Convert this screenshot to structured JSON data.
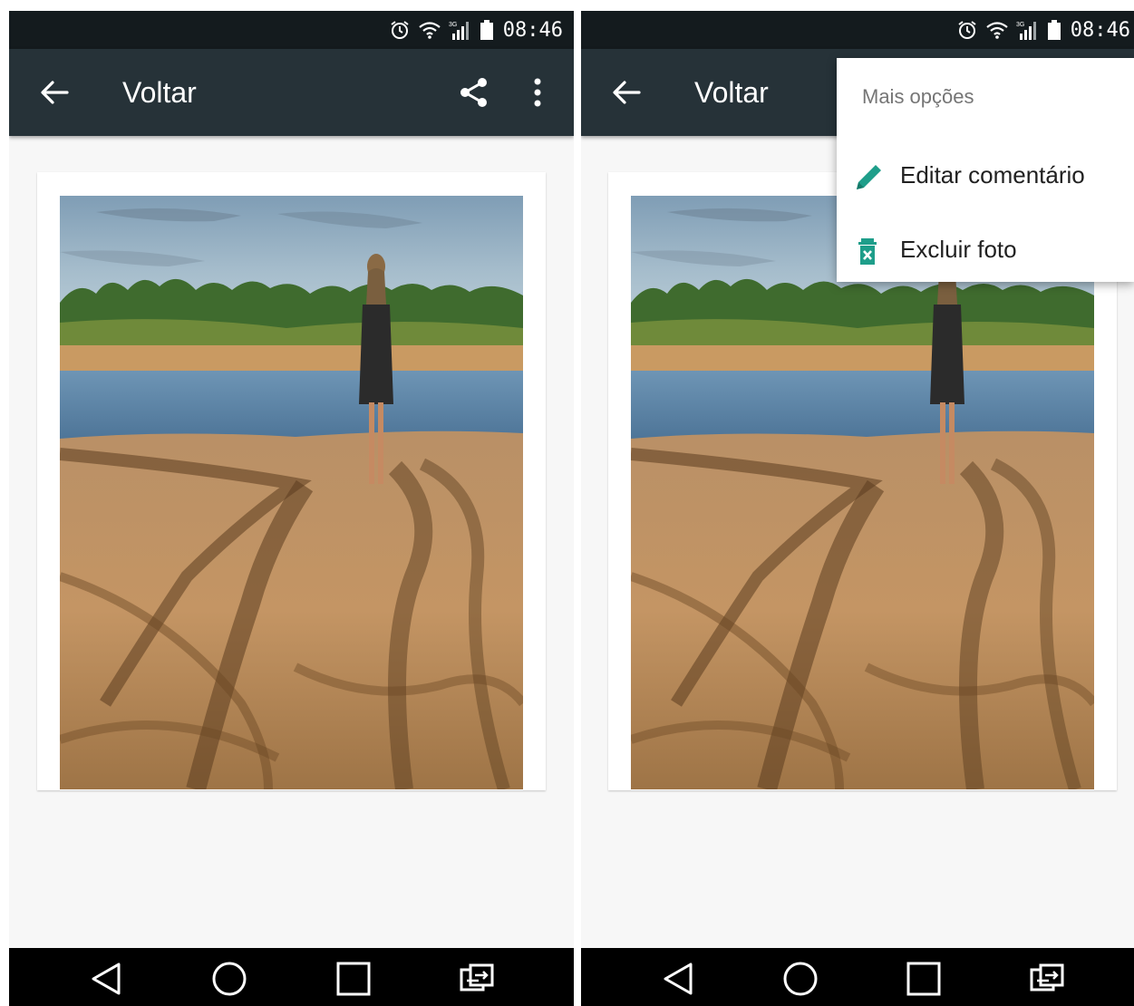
{
  "status_bar": {
    "time": "08:46"
  },
  "app_bar": {
    "title": "Voltar"
  },
  "overflow_menu": {
    "header": "Mais opções",
    "items": [
      {
        "label": "Editar comentário",
        "icon": "pencil-icon",
        "color": "#1e9e8a"
      },
      {
        "label": "Excluir foto",
        "icon": "trash-icon",
        "color": "#1e9e8a"
      }
    ]
  },
  "colors": {
    "app_bar": "#263238",
    "status_bar": "#141b1e",
    "accent": "#1e9e8a",
    "nav_bar": "#000000"
  }
}
